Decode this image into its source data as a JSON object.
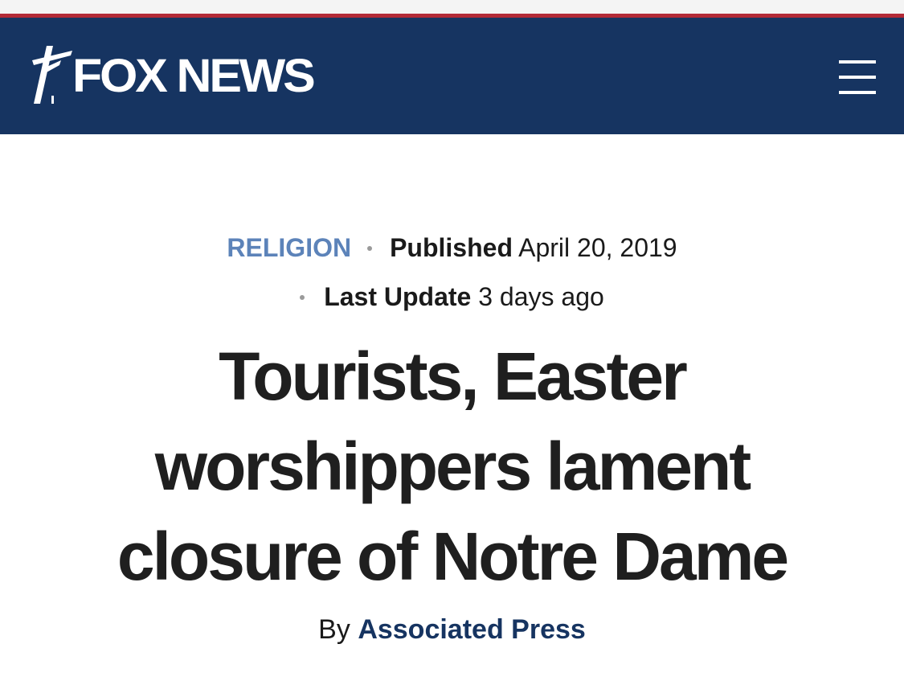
{
  "header": {
    "logo_text": "FOX NEWS",
    "menu_icon": "hamburger-menu-icon",
    "background_color": "#163461",
    "accent_line_color": "#b32a36"
  },
  "article": {
    "category": "RELIGION",
    "published_label": "Published",
    "published_date": "April 20, 2019",
    "updated_label": "Last Update",
    "updated_value": "3 days ago",
    "headline": "Tourists, Easter worshippers lament closure of Notre Dame",
    "byline_prefix": "By",
    "author": "Associated Press",
    "category_color": "#5c83b9"
  }
}
